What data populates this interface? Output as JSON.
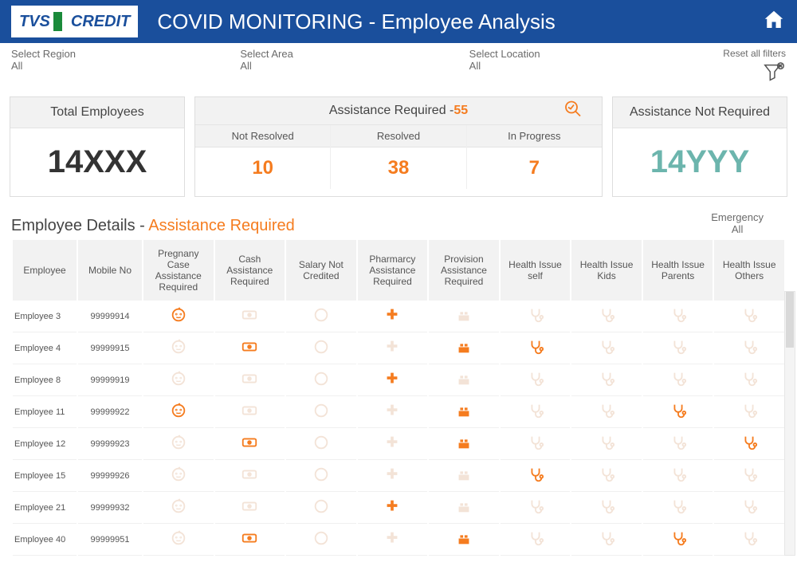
{
  "header": {
    "logo_text_1": "TVS",
    "logo_text_2": "CREDIT",
    "title": "COVID MONITORING - Employee Analysis"
  },
  "filters": {
    "region": {
      "label": "Select Region",
      "value": "All"
    },
    "area": {
      "label": "Select Area",
      "value": "All"
    },
    "location": {
      "label": "Select Location",
      "value": "All"
    },
    "reset_label": "Reset all filters"
  },
  "cards": {
    "total": {
      "title": "Total Employees",
      "value": "14XXX"
    },
    "assist": {
      "title": "Assistance Required - ",
      "count": "55",
      "cols": [
        {
          "label": "Not Resolved",
          "value": "10"
        },
        {
          "label": "Resolved",
          "value": "38"
        },
        {
          "label": "In Progress",
          "value": "7"
        }
      ]
    },
    "not_required": {
      "title": "Assistance Not Required",
      "value": "14YYY"
    }
  },
  "details": {
    "title_prefix": "Employee Details - ",
    "title_highlight": "Assistance Required",
    "emergency_label": "Emergency",
    "emergency_value": "All",
    "columns": [
      "Employee",
      "Mobile No",
      "Pregnany Case Assistance Required",
      "Cash Assistance Required",
      "Salary Not Credited",
      "Pharmarcy Assistance Required",
      "Provision Assistance Required",
      "Health Issue self",
      "Health Issue Kids",
      "Health Issue Parents",
      "Health Issue Others"
    ],
    "rows": [
      {
        "employee": "Employee 3",
        "mobile": "99999914",
        "flags": {
          "pregnancy": true,
          "cash": false,
          "salary": false,
          "pharmacy": true,
          "provision": false,
          "health_self": false,
          "health_kids": false,
          "health_parents": false,
          "health_others": false
        }
      },
      {
        "employee": "Employee 4",
        "mobile": "99999915",
        "flags": {
          "pregnancy": false,
          "cash": true,
          "salary": false,
          "pharmacy": false,
          "provision": true,
          "health_self": true,
          "health_kids": false,
          "health_parents": false,
          "health_others": false
        }
      },
      {
        "employee": "Employee 8",
        "mobile": "99999919",
        "flags": {
          "pregnancy": false,
          "cash": false,
          "salary": false,
          "pharmacy": true,
          "provision": false,
          "health_self": false,
          "health_kids": false,
          "health_parents": false,
          "health_others": false
        }
      },
      {
        "employee": "Employee 11",
        "mobile": "99999922",
        "flags": {
          "pregnancy": true,
          "cash": false,
          "salary": false,
          "pharmacy": false,
          "provision": true,
          "health_self": false,
          "health_kids": false,
          "health_parents": true,
          "health_others": false
        }
      },
      {
        "employee": "Employee 12",
        "mobile": "99999923",
        "flags": {
          "pregnancy": false,
          "cash": true,
          "salary": false,
          "pharmacy": false,
          "provision": true,
          "health_self": false,
          "health_kids": false,
          "health_parents": false,
          "health_others": true
        }
      },
      {
        "employee": "Employee 15",
        "mobile": "99999926",
        "flags": {
          "pregnancy": false,
          "cash": false,
          "salary": false,
          "pharmacy": false,
          "provision": false,
          "health_self": true,
          "health_kids": false,
          "health_parents": false,
          "health_others": false
        }
      },
      {
        "employee": "Employee 21",
        "mobile": "99999932",
        "flags": {
          "pregnancy": false,
          "cash": false,
          "salary": false,
          "pharmacy": true,
          "provision": false,
          "health_self": false,
          "health_kids": false,
          "health_parents": false,
          "health_others": false
        }
      },
      {
        "employee": "Employee 40",
        "mobile": "99999951",
        "flags": {
          "pregnancy": false,
          "cash": true,
          "salary": false,
          "pharmacy": false,
          "provision": true,
          "health_self": false,
          "health_kids": false,
          "health_parents": true,
          "health_others": false
        }
      }
    ]
  }
}
